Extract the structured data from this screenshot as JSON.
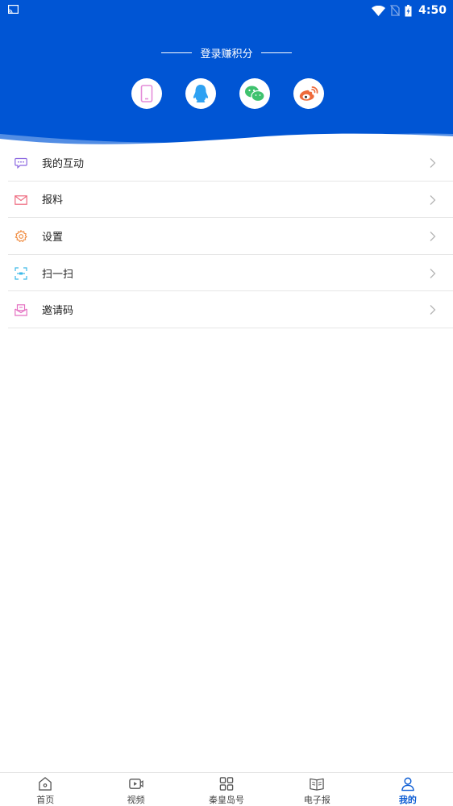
{
  "status_bar": {
    "time": "4:50",
    "icons": [
      "cast-icon",
      "wifi-icon",
      "no-sim-icon",
      "battery-charging-icon"
    ]
  },
  "header": {
    "title": "登录赚积分",
    "login_options": [
      {
        "icon": "phone-icon",
        "color": "#e48cd9"
      },
      {
        "icon": "qq-icon",
        "color": "#2ea1f2"
      },
      {
        "icon": "wechat-icon",
        "color": "#3fc26e"
      },
      {
        "icon": "weibo-icon",
        "color": "#ee6a3b"
      }
    ],
    "background_color": "#0055d4"
  },
  "menu": {
    "items": [
      {
        "label": "我的互动",
        "icon": "chat-bubble-icon",
        "color": "#8a66e0"
      },
      {
        "label": "报料",
        "icon": "mail-icon",
        "color": "#ee6a7f"
      },
      {
        "label": "设置",
        "icon": "settings-icon",
        "color": "#f0883a"
      },
      {
        "label": "扫一扫",
        "icon": "scan-icon",
        "color": "#3cb9e8"
      },
      {
        "label": "邀请码",
        "icon": "invite-envelope-icon",
        "color": "#e46fc1"
      }
    ]
  },
  "tabbar": {
    "tabs": [
      {
        "label": "首页",
        "icon": "home-icon",
        "active": false
      },
      {
        "label": "视频",
        "icon": "video-icon",
        "active": false
      },
      {
        "label": "秦皇岛号",
        "icon": "grid-icon",
        "active": false
      },
      {
        "label": "电子报",
        "icon": "newspaper-icon",
        "active": false
      },
      {
        "label": "我的",
        "icon": "user-icon",
        "active": true
      }
    ],
    "active_color": "#0a5bd3"
  }
}
